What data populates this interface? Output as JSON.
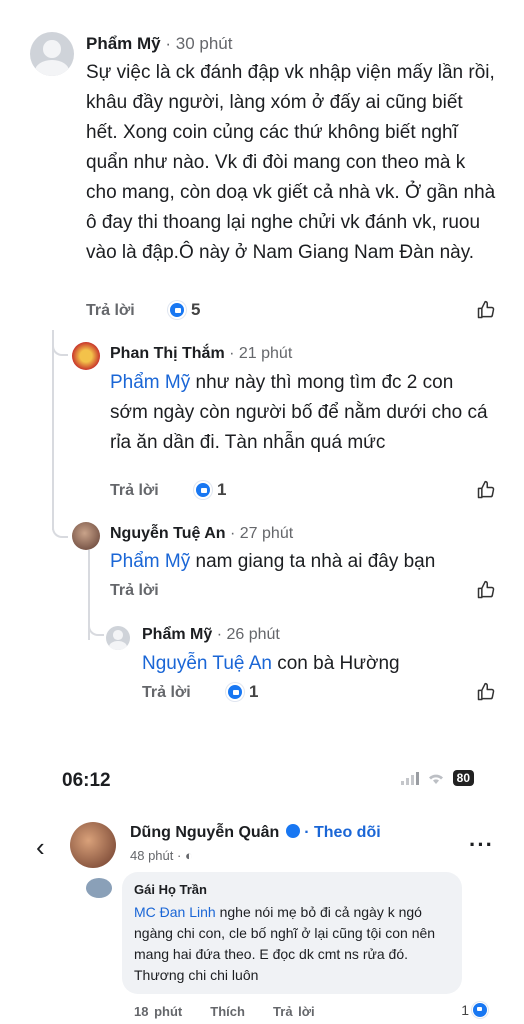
{
  "comments": [
    {
      "name": "Phẩm Mỹ",
      "time": " · 30 phút",
      "text": "Sự việc là ck đánh đập vk nhập viện mấy lần rồi, khâu đầy người, làng xóm ở đấy ai cũng biết hết. Xong coin củng các thứ không biết nghĩ quẩn như nào. Vk đi đòi mang con theo mà k cho mang, còn doạ vk giết cả nhà vk. Ở gần nhà ô đay thi thoang lại nghe chửi vk đánh vk, ruou vào là đập.Ô này ở Nam Giang Nam Đàn này.",
      "reply_label": "Trả lời",
      "reactions": "5"
    },
    {
      "name": "Phan Thị Thắm",
      "time": " · 21 phút",
      "mention": "Phẩm Mỹ",
      "text": " như này thì mong tìm đc 2 con sớm ngày còn người bố để nằm dưới cho cá rỉa ăn dần đi. Tàn nhẫn quá mức",
      "reply_label": "Trả lời",
      "reactions": "1"
    },
    {
      "name": "Nguyễn Tuệ An",
      "time": " · 27 phút",
      "mention": "Phẩm Mỹ",
      "text": " nam giang ta nhà ai đây bạn",
      "reply_label": "Trả lời"
    },
    {
      "name": "Phẩm Mỹ",
      "time": " · 26 phút",
      "mention": "Nguyễn Tuệ An",
      "text": " con bà Hường",
      "reply_label": "Trả lời",
      "reactions": "1"
    }
  ],
  "status_bar": {
    "time": "06:12",
    "battery": "80"
  },
  "post": {
    "author": "Dũng Nguyễn Quân",
    "follow": " · Theo dõi",
    "time": "48 phút · ",
    "back_icon": "chevron-left-icon",
    "more_icon": "more-icon"
  },
  "bottom_comment": {
    "name": "Gái Họ Trần",
    "mention": "MC Đan Linh",
    "text": " nghe nói mẹ bỏ đi cả ngày k ngó ngàng chi con, cle bố nghĩ ở lại cũng tội con nên mang hai đứa theo. E đọc dk cmt ns rửa đó. Thương chi chi luôn",
    "time": "18 phút",
    "like_label": "Thích",
    "reply_label": "Trả lời",
    "reactions": "1"
  },
  "colors": {
    "link": "#1a66d6",
    "like": "#1877f2",
    "muted": "#65676b"
  }
}
